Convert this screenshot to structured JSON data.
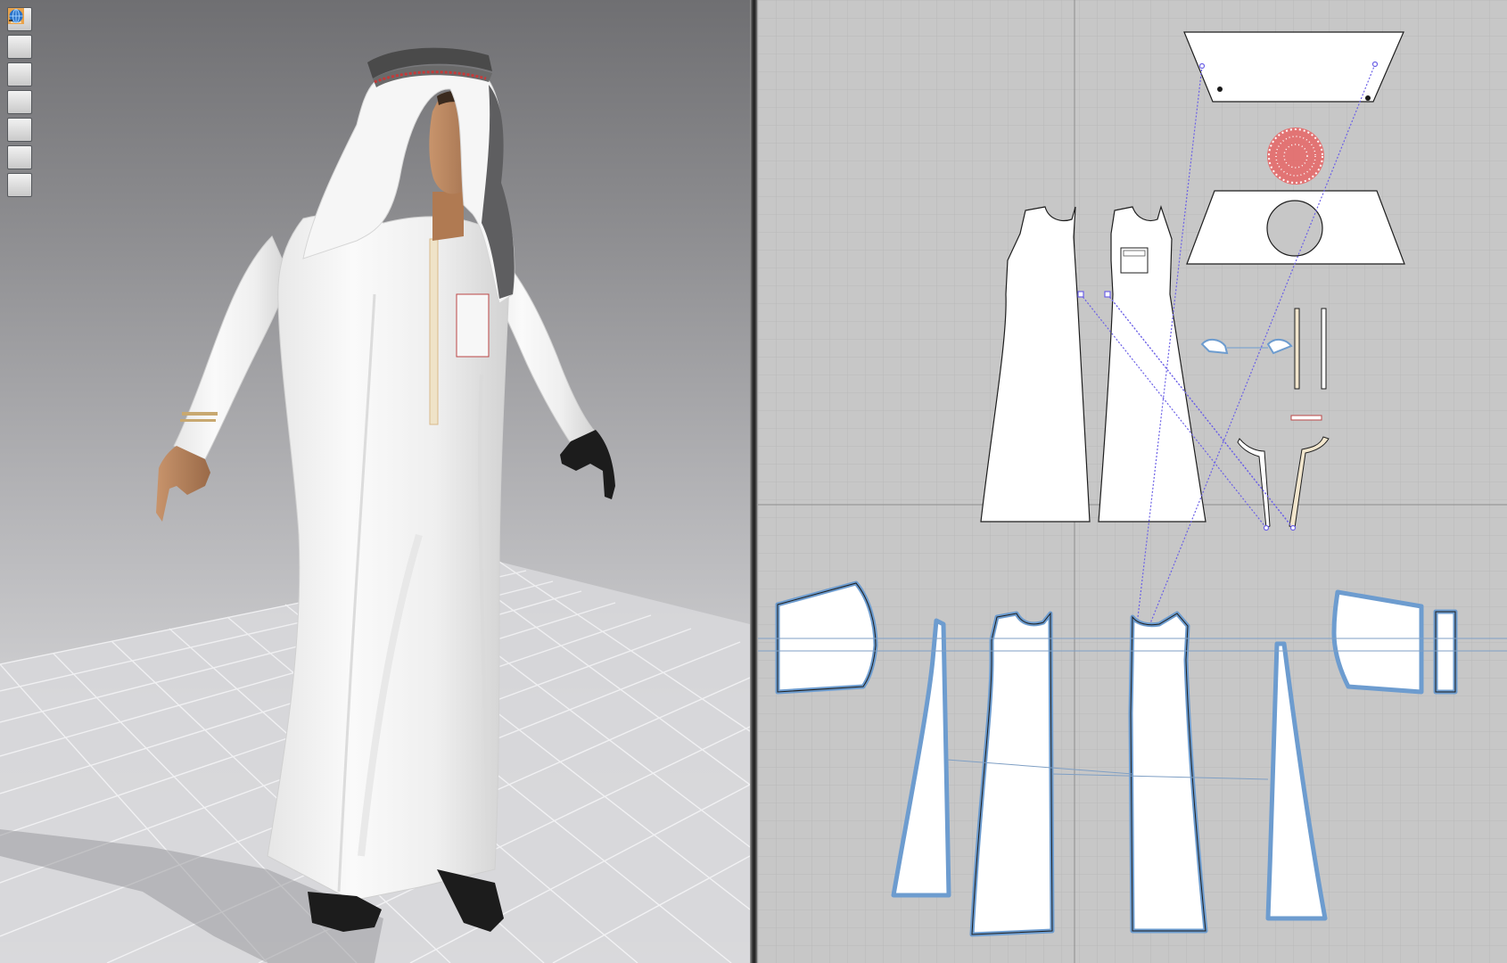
{
  "toolbar": {
    "tools": [
      {
        "icon": "garment-icon"
      },
      {
        "icon": "simulation-icon"
      },
      {
        "icon": "avatar-icon"
      },
      {
        "icon": "texture-view-icon"
      },
      {
        "icon": "shading-icon"
      },
      {
        "icon": "avatar-skin-icon"
      },
      {
        "icon": "environment-globe-icon"
      }
    ]
  },
  "colors": {
    "viewport3d_top": "#6f6f72",
    "viewport3d_bottom": "#e4e4e6",
    "pattern_bg": "#c7c7c7",
    "pattern_grid": "#b6b6b6",
    "pattern_fill": "#ffffff",
    "selection_outline": "#6d9ccf",
    "sewing_line": "#6b60e6",
    "fabric_white": "#f4f4f4",
    "cord_black": "#1c1c1c"
  }
}
